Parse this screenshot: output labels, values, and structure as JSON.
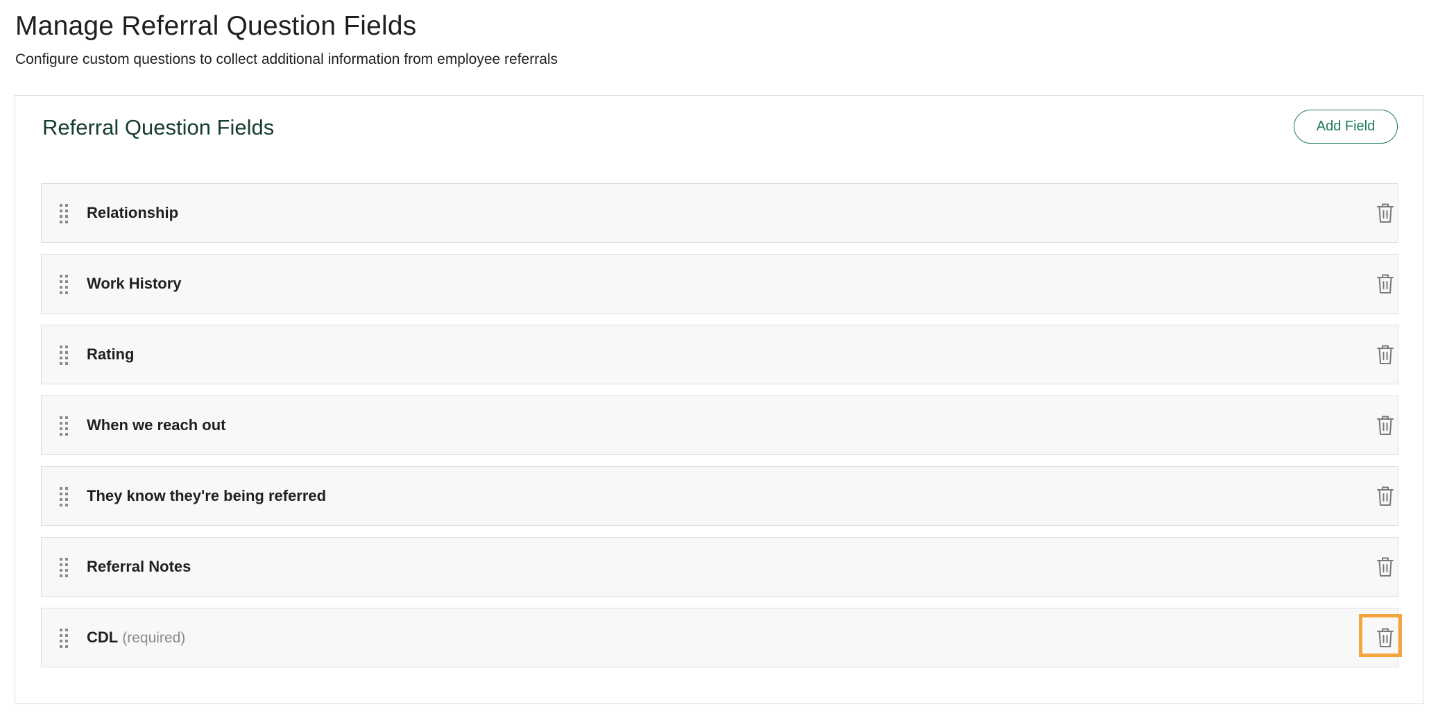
{
  "header": {
    "title": "Manage Referral Question Fields",
    "subtitle": "Configure custom questions to collect additional information from employee referrals"
  },
  "card": {
    "title": "Referral Question Fields",
    "add_button_label": "Add Field"
  },
  "fields": [
    {
      "label": "Relationship",
      "required_note": ""
    },
    {
      "label": "Work History",
      "required_note": ""
    },
    {
      "label": "Rating",
      "required_note": ""
    },
    {
      "label": "When we reach out",
      "required_note": ""
    },
    {
      "label": "They know they're being referred",
      "required_note": ""
    },
    {
      "label": "Referral Notes",
      "required_note": ""
    },
    {
      "label": "CDL",
      "required_note": "(required)"
    }
  ],
  "icons": {
    "drag": "drag-handle-icon",
    "delete": "trash-icon"
  },
  "colors": {
    "accent": "#1f7a5a",
    "card_title": "#163d2e",
    "highlight": "#f2a53c",
    "row_background": "#f8f8f8",
    "icon_gray": "#7a7a7a"
  }
}
